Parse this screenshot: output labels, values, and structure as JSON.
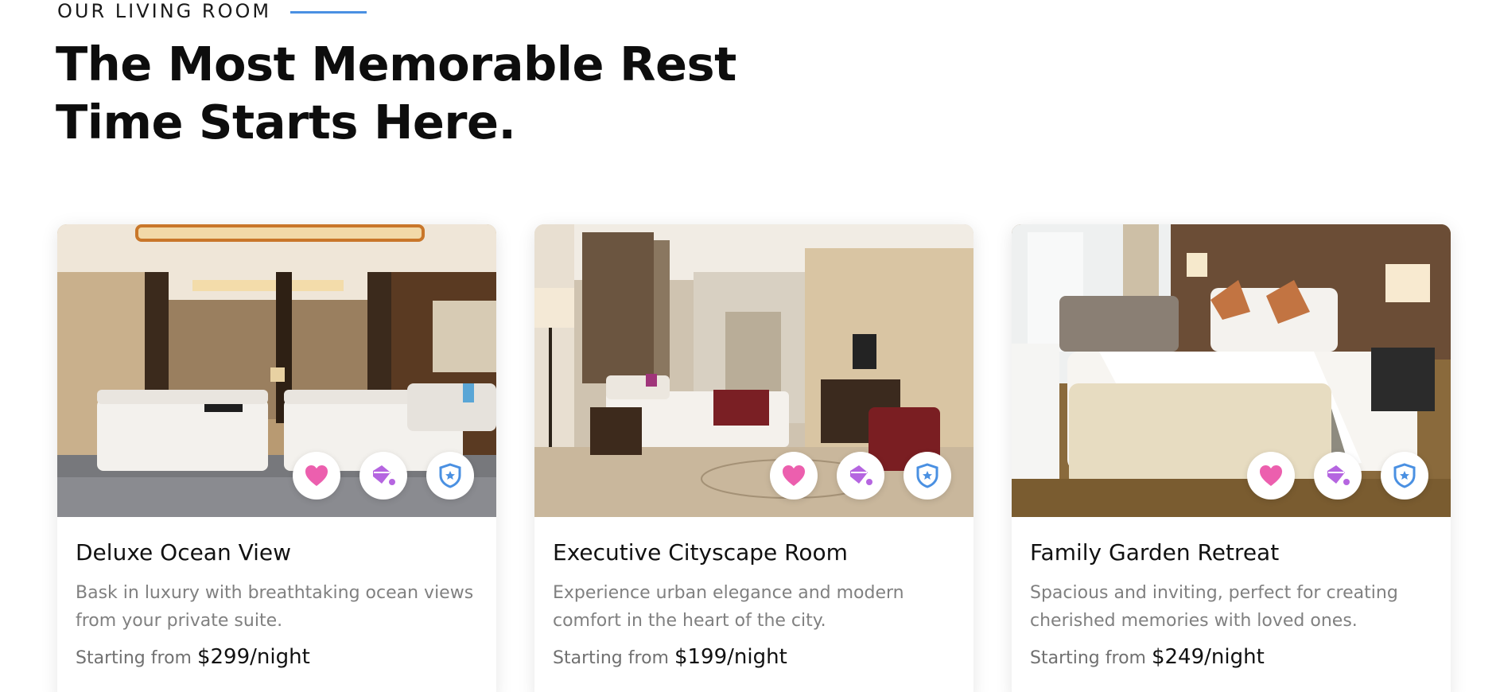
{
  "section": {
    "eyebrow": "OUR LIVING ROOM",
    "headline_line1": "The Most Memorable Rest",
    "headline_line2": "Time Starts Here.",
    "accent_color": "#4a90e2"
  },
  "icons": {
    "favorite": "heart-icon",
    "paint": "paint-bucket-icon",
    "security": "shield-star-icon",
    "favorite_color": "#ec5fae",
    "paint_color": "#b565e0",
    "security_color": "#4a90e2"
  },
  "rooms": [
    {
      "title": "Deluxe Ocean View",
      "description": "Bask in luxury with breathtaking ocean views from your private suite.",
      "price_label": "Starting from",
      "price": "$299/night"
    },
    {
      "title": "Executive Cityscape Room",
      "description": "Experience urban elegance and modern comfort in the heart of the city.",
      "price_label": "Starting from",
      "price": "$199/night"
    },
    {
      "title": "Family Garden Retreat",
      "description": "Spacious and inviting, perfect for creating cherished memories with loved ones.",
      "price_label": "Starting from",
      "price": "$249/night"
    }
  ]
}
